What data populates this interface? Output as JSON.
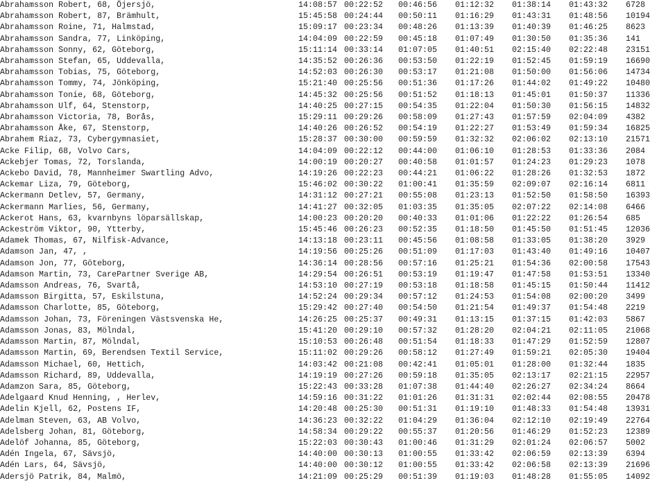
{
  "page": {
    "title": "Race results listing",
    "background_color": "#ffffff",
    "text_color": "#1d1d1d",
    "row_count": 42,
    "column_count": 8
  },
  "columns": [
    {
      "key": "runner",
      "label": ""
    },
    {
      "key": "start",
      "label": ""
    },
    {
      "key": "split_1",
      "label": ""
    },
    {
      "key": "split_2",
      "label": ""
    },
    {
      "key": "split_3",
      "label": ""
    },
    {
      "key": "split_4",
      "label": ""
    },
    {
      "key": "finish",
      "label": ""
    },
    {
      "key": "place",
      "label": ""
    }
  ],
  "rows": [
    {
      "runner": "Abrahamsson Robert, 68, Öjersjö,",
      "start": "14:08:57",
      "split_1": "00:22:52",
      "split_2": "00:46:56",
      "split_3": "01:12:32",
      "split_4": "01:38:14",
      "finish": "01:43:32",
      "place": "6728"
    },
    {
      "runner": "Abrahamsson Robert, 87, Brämhult,",
      "start": "15:45:58",
      "split_1": "00:24:44",
      "split_2": "00:50:11",
      "split_3": "01:16:29",
      "split_4": "01:43:31",
      "finish": "01:48:56",
      "place": "10194"
    },
    {
      "runner": "Abrahamsson Roine, 71, Halmstad,",
      "start": "15:09:17",
      "split_1": "00:23:34",
      "split_2": "00:48:26",
      "split_3": "01:13:39",
      "split_4": "01:40:39",
      "finish": "01:46:25",
      "place": "8623"
    },
    {
      "runner": "Abrahamsson Sandra, 77, Linköping,",
      "start": "14:04:09",
      "split_1": "00:22:59",
      "split_2": "00:45:18",
      "split_3": "01:07:49",
      "split_4": "01:30:50",
      "finish": "01:35:36",
      "place": "141"
    },
    {
      "runner": "Abrahamsson Sonny, 62, Göteborg,",
      "start": "15:11:14",
      "split_1": "00:33:14",
      "split_2": "01:07:05",
      "split_3": "01:40:51",
      "split_4": "02:15:40",
      "finish": "02:22:48",
      "place": "23151"
    },
    {
      "runner": "Abrahamsson Stefan, 65, Uddevalla,",
      "start": "14:35:52",
      "split_1": "00:26:36",
      "split_2": "00:53:50",
      "split_3": "01:22:19",
      "split_4": "01:52:45",
      "finish": "01:59:19",
      "place": "16690"
    },
    {
      "runner": "Abrahamsson Tobias, 75, Göteborg,",
      "start": "14:52:03",
      "split_1": "00:26:30",
      "split_2": "00:53:17",
      "split_3": "01:21:08",
      "split_4": "01:50:00",
      "finish": "01:56:06",
      "place": "14734"
    },
    {
      "runner": "Abrahamsson Tommy, 74, Jönköping,",
      "start": "15:21:40",
      "split_1": "00:25:56",
      "split_2": "00:51:36",
      "split_3": "01:17:26",
      "split_4": "01:44:02",
      "finish": "01:49:22",
      "place": "10480"
    },
    {
      "runner": "Abrahamsson Tonie, 68, Göteborg,",
      "start": "14:45:32",
      "split_1": "00:25:56",
      "split_2": "00:51:52",
      "split_3": "01:18:13",
      "split_4": "01:45:01",
      "finish": "01:50:37",
      "place": "11336"
    },
    {
      "runner": "Abrahamsson Ulf, 64, Stenstorp,",
      "start": "14:40:25",
      "split_1": "00:27:15",
      "split_2": "00:54:35",
      "split_3": "01:22:04",
      "split_4": "01:50:30",
      "finish": "01:56:15",
      "place": "14832"
    },
    {
      "runner": "Abrahamsson Victoria, 78, Borås,",
      "start": "15:29:11",
      "split_1": "00:29:26",
      "split_2": "00:58:09",
      "split_3": "01:27:43",
      "split_4": "01:57:59",
      "finish": "02:04:09",
      "place": "4382"
    },
    {
      "runner": "Abrahamsson Åke, 67, Stenstorp,",
      "start": "14:40:26",
      "split_1": "00:26:52",
      "split_2": "00:54:19",
      "split_3": "01:22:27",
      "split_4": "01:53:49",
      "finish": "01:59:34",
      "place": "16825"
    },
    {
      "runner": "Abrahem Riaz, 73, Cybergymnasiet,",
      "start": "15:28:37",
      "split_1": "00:30:00",
      "split_2": "00:59:59",
      "split_3": "01:32:32",
      "split_4": "02:06:02",
      "finish": "02:13:10",
      "place": "21571"
    },
    {
      "runner": "Acke Filip, 68, Volvo Cars,",
      "start": "14:04:09",
      "split_1": "00:22:12",
      "split_2": "00:44:00",
      "split_3": "01:06:10",
      "split_4": "01:28:53",
      "finish": "01:33:36",
      "place": "2084"
    },
    {
      "runner": "Ackebjer Tomas, 72, Torslanda,",
      "start": "14:00:19",
      "split_1": "00:20:27",
      "split_2": "00:40:58",
      "split_3": "01:01:57",
      "split_4": "01:24:23",
      "finish": "01:29:23",
      "place": "1078"
    },
    {
      "runner": "Ackebo David, 78, Mannheimer Swartling Advo,",
      "start": "14:19:26",
      "split_1": "00:22:23",
      "split_2": "00:44:21",
      "split_3": "01:06:22",
      "split_4": "01:28:26",
      "finish": "01:32:53",
      "place": "1872"
    },
    {
      "runner": "Ackemar Liza, 79, Göteborg,",
      "start": "15:46:02",
      "split_1": "00:30:22",
      "split_2": "01:00:41",
      "split_3": "01:35:59",
      "split_4": "02:09:07",
      "finish": "02:16:14",
      "place": "6811"
    },
    {
      "runner": "Ackermann Detlev, 57, Germany,",
      "start": "14:31:12",
      "split_1": "00:27:21",
      "split_2": "00:55:08",
      "split_3": "01:23:13",
      "split_4": "01:52:50",
      "finish": "01:58:50",
      "place": "16393"
    },
    {
      "runner": "Ackermann Marlies, 56, Germany,",
      "start": "14:41:27",
      "split_1": "00:32:05",
      "split_2": "01:03:35",
      "split_3": "01:35:05",
      "split_4": "02:07:22",
      "finish": "02:14:08",
      "place": "6466"
    },
    {
      "runner": "Ackerot Hans, 63, kvarnbyns löparsällskap,",
      "start": "14:00:23",
      "split_1": "00:20:20",
      "split_2": "00:40:33",
      "split_3": "01:01:06",
      "split_4": "01:22:22",
      "finish": "01:26:54",
      "place": "685"
    },
    {
      "runner": "Ackeström Viktor, 90, Ytterby,",
      "start": "15:45:46",
      "split_1": "00:26:23",
      "split_2": "00:52:35",
      "split_3": "01:18:50",
      "split_4": "01:45:50",
      "finish": "01:51:45",
      "place": "12036"
    },
    {
      "runner": "Adamek Thomas, 67, Nilfisk-Advance,",
      "start": "14:13:18",
      "split_1": "00:23:11",
      "split_2": "00:45:56",
      "split_3": "01:08:58",
      "split_4": "01:33:05",
      "finish": "01:38:20",
      "place": "3929"
    },
    {
      "runner": "Adamson Jan, 47, ,",
      "start": "14:19:56",
      "split_1": "00:25:26",
      "split_2": "00:51:09",
      "split_3": "01:17:03",
      "split_4": "01:43:40",
      "finish": "01:49:16",
      "place": "10407"
    },
    {
      "runner": "Adamson Jon, 77, Göteborg,",
      "start": "14:36:14",
      "split_1": "00:28:56",
      "split_2": "00:57:16",
      "split_3": "01:25:21",
      "split_4": "01:54:36",
      "finish": "02:00:58",
      "place": "17543"
    },
    {
      "runner": "Adamson Martin, 73, CarePartner Sverige AB,",
      "start": "14:29:54",
      "split_1": "00:26:51",
      "split_2": "00:53:19",
      "split_3": "01:19:47",
      "split_4": "01:47:58",
      "finish": "01:53:51",
      "place": "13340"
    },
    {
      "runner": "Adamsson Andreas, 76, Svartå,",
      "start": "14:53:10",
      "split_1": "00:27:19",
      "split_2": "00:53:18",
      "split_3": "01:18:58",
      "split_4": "01:45:15",
      "finish": "01:50:44",
      "place": "11412"
    },
    {
      "runner": "Adamsson Birgitta, 57, Eskilstuna,",
      "start": "14:52:24",
      "split_1": "00:29:34",
      "split_2": "00:57:12",
      "split_3": "01:24:53",
      "split_4": "01:54:08",
      "finish": "02:00:20",
      "place": "3499"
    },
    {
      "runner": "Adamsson Charlotte, 85, Göteborg,",
      "start": "15:29:42",
      "split_1": "00:27:40",
      "split_2": "00:54:50",
      "split_3": "01:21:54",
      "split_4": "01:49:37",
      "finish": "01:54:48",
      "place": "2219"
    },
    {
      "runner": "Adamsson Johan, 73, Föreningen Västsvenska He,",
      "start": "14:26:25",
      "split_1": "00:25:37",
      "split_2": "00:49:31",
      "split_3": "01:13:15",
      "split_4": "01:37:15",
      "finish": "01:42:03",
      "place": "5867"
    },
    {
      "runner": "Adamsson Jonas, 83, Mölndal,",
      "start": "15:41:20",
      "split_1": "00:29:10",
      "split_2": "00:57:32",
      "split_3": "01:28:20",
      "split_4": "02:04:21",
      "finish": "02:11:05",
      "place": "21068"
    },
    {
      "runner": "Adamsson Martin, 87, Mölndal,",
      "start": "15:10:53",
      "split_1": "00:26:48",
      "split_2": "00:51:54",
      "split_3": "01:18:33",
      "split_4": "01:47:29",
      "finish": "01:52:59",
      "place": "12807"
    },
    {
      "runner": "Adamsson Martin, 69, Berendsen Textil Service,",
      "start": "15:11:02",
      "split_1": "00:29:26",
      "split_2": "00:58:12",
      "split_3": "01:27:49",
      "split_4": "01:59:21",
      "finish": "02:05:30",
      "place": "19404"
    },
    {
      "runner": "Adamsson Michael, 60, Hettich,",
      "start": "14:03:42",
      "split_1": "00:21:08",
      "split_2": "00:42:41",
      "split_3": "01:05:01",
      "split_4": "01:28:00",
      "finish": "01:32:44",
      "place": "1835"
    },
    {
      "runner": "Adamsson Richard, 89, Uddevalla,",
      "start": "14:19:19",
      "split_1": "00:27:26",
      "split_2": "00:59:18",
      "split_3": "01:35:05",
      "split_4": "02:13:17",
      "finish": "02:21:15",
      "place": "22957"
    },
    {
      "runner": "Adamzon Sara, 85, Göteborg,",
      "start": "15:22:43",
      "split_1": "00:33:28",
      "split_2": "01:07:38",
      "split_3": "01:44:40",
      "split_4": "02:26:27",
      "finish": "02:34:24",
      "place": "8664"
    },
    {
      "runner": "Adelgaard Knud Henning, , Herlev,",
      "start": "14:59:16",
      "split_1": "00:31:22",
      "split_2": "01:01:26",
      "split_3": "01:31:31",
      "split_4": "02:02:44",
      "finish": "02:08:55",
      "place": "20478"
    },
    {
      "runner": "Adelin Kjell, 62, Postens IF,",
      "start": "14:20:48",
      "split_1": "00:25:30",
      "split_2": "00:51:31",
      "split_3": "01:19:10",
      "split_4": "01:48:33",
      "finish": "01:54:48",
      "place": "13931"
    },
    {
      "runner": "Adelman Steven, 63, AB Volvo,",
      "start": "14:36:23",
      "split_1": "00:32:22",
      "split_2": "01:04:29",
      "split_3": "01:36:04",
      "split_4": "02:12:10",
      "finish": "02:19:49",
      "place": "22764"
    },
    {
      "runner": "Adelsberg Johan, 81, Göteborg,",
      "start": "14:58:34",
      "split_1": "00:29:22",
      "split_2": "00:55:37",
      "split_3": "01:20:56",
      "split_4": "01:46:29",
      "finish": "01:52:23",
      "place": "12389"
    },
    {
      "runner": "Adelöf Johanna, 85, Göteborg,",
      "start": "15:22:03",
      "split_1": "00:30:43",
      "split_2": "01:00:46",
      "split_3": "01:31:29",
      "split_4": "02:01:24",
      "finish": "02:06:57",
      "place": "5002"
    },
    {
      "runner": "Adén Ingela, 67, Sävsjö,",
      "start": "14:40:00",
      "split_1": "00:30:13",
      "split_2": "01:00:55",
      "split_3": "01:33:42",
      "split_4": "02:06:59",
      "finish": "02:13:39",
      "place": "6394"
    },
    {
      "runner": "Adén Lars, 64, Sävsjö,",
      "start": "14:40:00",
      "split_1": "00:30:12",
      "split_2": "01:00:55",
      "split_3": "01:33:42",
      "split_4": "02:06:58",
      "finish": "02:13:39",
      "place": "21696"
    },
    {
      "runner": "Adersjö Patrik, 84, Malmö,",
      "start": "14:21:09",
      "split_1": "00:25:29",
      "split_2": "00:51:39",
      "split_3": "01:19:03",
      "split_4": "01:48:28",
      "finish": "01:55:05",
      "place": "14092"
    }
  ]
}
